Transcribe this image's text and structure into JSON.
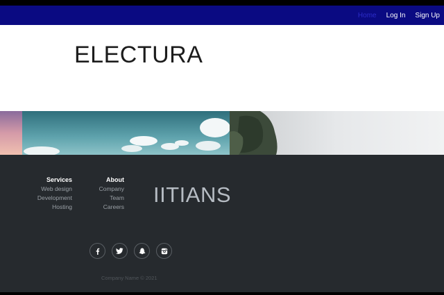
{
  "nav": {
    "links": [
      {
        "label": "Home",
        "active": true
      },
      {
        "label": "Log In",
        "active": false
      },
      {
        "label": "Sign Up",
        "active": false
      }
    ]
  },
  "hero": {
    "brand": "ELECTURA"
  },
  "footer": {
    "services": {
      "title": "Services",
      "links": [
        "Web design",
        "Development",
        "Hosting"
      ]
    },
    "about": {
      "title": "About",
      "links": [
        "Company",
        "Team",
        "Careers"
      ]
    },
    "brand": "IITIANS",
    "social": [
      "facebook-icon",
      "twitter-icon",
      "snapchat-icon",
      "instagram-icon"
    ],
    "copyright": "Company Name © 2021"
  },
  "colors": {
    "navbar": "#0a0a82",
    "footer": "#262a2e",
    "nav_active": "#2c2cc8"
  }
}
